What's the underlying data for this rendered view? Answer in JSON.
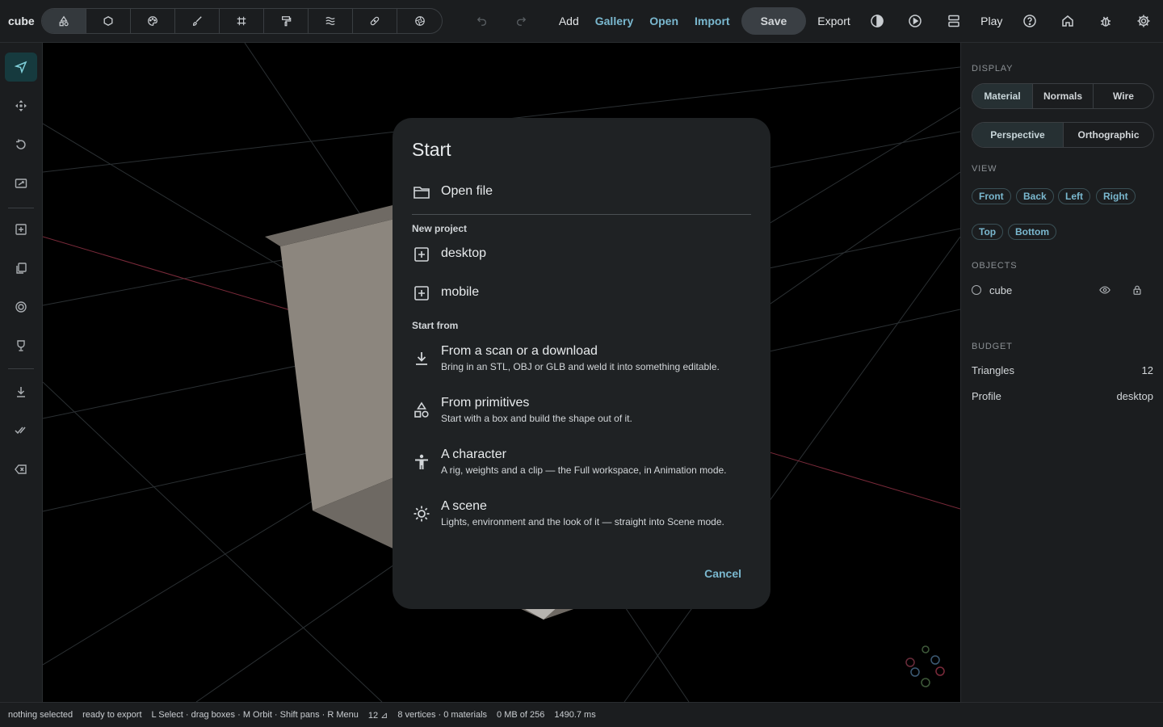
{
  "app": {
    "title": "cube"
  },
  "toolbar": {
    "tools": [
      "shapes-icon",
      "circle-icon",
      "palette-icon",
      "brush-icon",
      "grid-icon",
      "paint-roller-icon",
      "waves-icon",
      "bandage-icon",
      "aperture-icon"
    ],
    "undo_icon": "undo-icon",
    "redo_icon": "redo-icon",
    "add_label": "Add",
    "gallery_label": "Gallery",
    "open_label": "Open",
    "import_label": "Import",
    "save_label": "Save",
    "export_label": "Export",
    "play_label": "Play"
  },
  "left_rail": {
    "items": [
      "select-icon",
      "move-icon",
      "rotate-icon",
      "scale-icon",
      "add-box-icon",
      "copy-icon",
      "target-icon",
      "trophy-icon",
      "download-icon",
      "check-all-icon",
      "delete-icon"
    ]
  },
  "dialog": {
    "title": "Start",
    "open_file_label": "Open file",
    "new_project_heading": "New project",
    "projects": [
      {
        "label": "desktop"
      },
      {
        "label": "mobile"
      }
    ],
    "start_from_heading": "Start from",
    "start_options": [
      {
        "title": "From a scan or a download",
        "subtitle": "Bring in an STL, OBJ or GLB and weld it into something editable."
      },
      {
        "title": "From primitives",
        "subtitle": "Start with a box and build the shape out of it."
      },
      {
        "title": "A character",
        "subtitle": "A rig, weights and a clip — the Full workspace, in Animation mode."
      },
      {
        "title": "A scene",
        "subtitle": "Lights, environment and the look of it — straight into Scene mode."
      }
    ],
    "cancel_label": "Cancel"
  },
  "right_panel": {
    "display_heading": "DISPLAY",
    "shading_modes": [
      "Material",
      "Normals",
      "Wire"
    ],
    "shading_selected": "Material",
    "projection_modes": [
      "Perspective",
      "Orthographic"
    ],
    "projection_selected": "Perspective",
    "view_heading": "VIEW",
    "view_buttons": [
      "Front",
      "Back",
      "Left",
      "Right",
      "Top",
      "Bottom"
    ],
    "objects_heading": "OBJECTS",
    "objects": [
      {
        "name": "cube"
      }
    ],
    "budget_heading": "BUDGET",
    "budget": [
      {
        "label": "Triangles",
        "value": "12"
      },
      {
        "label": "Profile",
        "value": "desktop"
      }
    ]
  },
  "status_bar": {
    "selection": "nothing selected",
    "export_state": "ready to export",
    "hints": "L Select · drag boxes · M Orbit · Shift pans · R Menu",
    "triangles": "12 ⊿",
    "stats": "8 vertices · 0 materials",
    "memory": "0 MB of 256",
    "frame_time": "1490.7 ms"
  },
  "colors": {
    "accent": "#7ab8cf",
    "panel": "#1b1d1f",
    "dialog": "#1f2224",
    "active_rail": "#163a3e"
  }
}
